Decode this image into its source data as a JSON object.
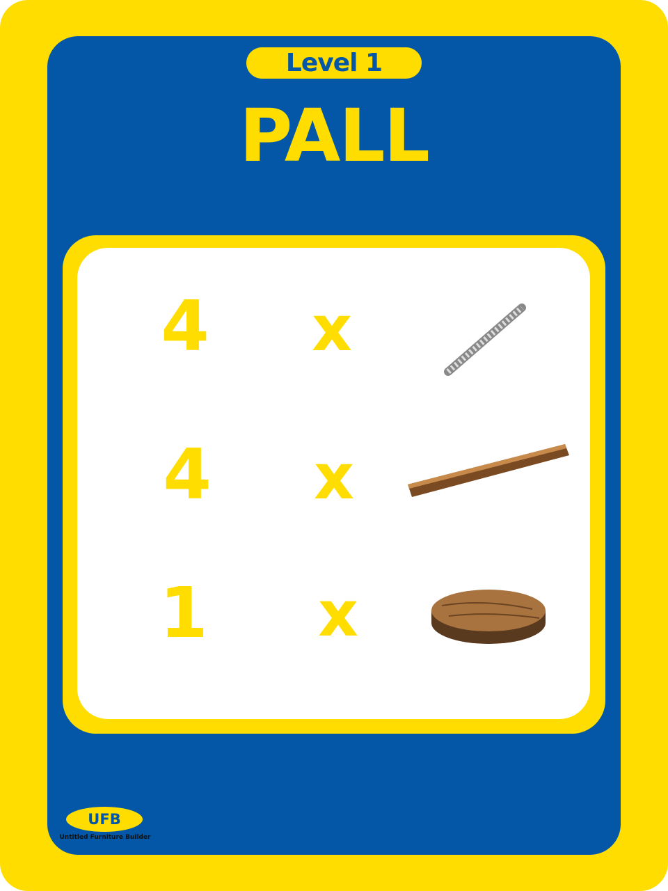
{
  "level_label": "Level 1",
  "title": "PALL",
  "parts": [
    {
      "quantity": "4",
      "multiplier": "x",
      "icon": "screw-icon"
    },
    {
      "quantity": "4",
      "multiplier": "x",
      "icon": "wooden-stick-icon"
    },
    {
      "quantity": "1",
      "multiplier": "x",
      "icon": "round-wooden-seat-icon"
    }
  ],
  "logo": {
    "text": "UFB",
    "subtitle": "Untitled Furniture Builder"
  },
  "colors": {
    "yellow": "#FFDD00",
    "blue": "#0357A6"
  }
}
